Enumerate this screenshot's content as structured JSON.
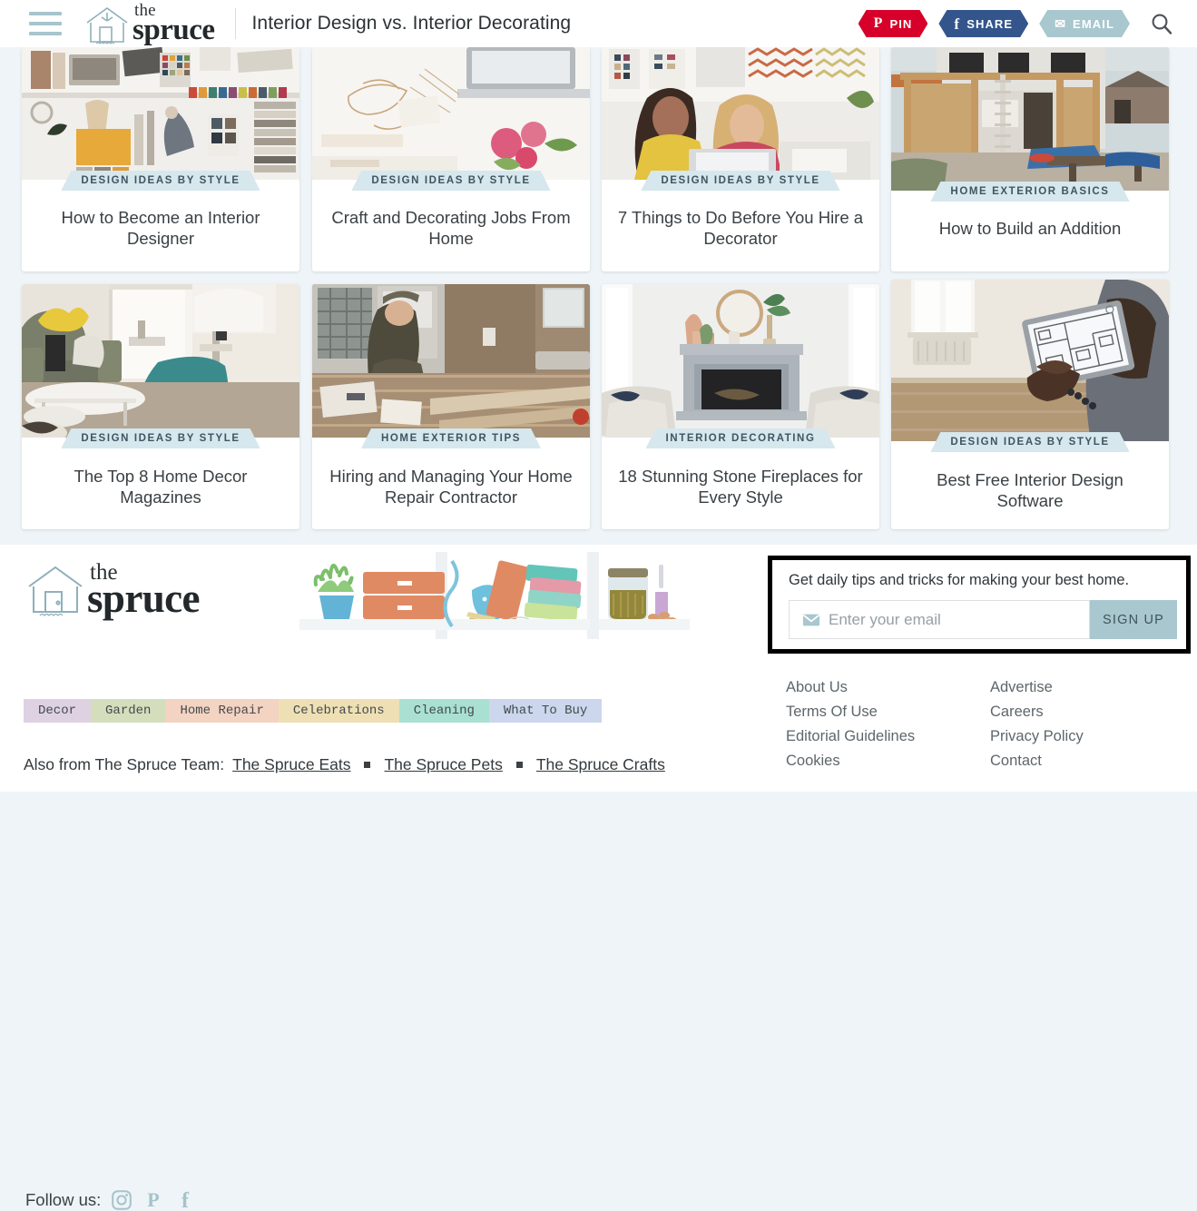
{
  "header": {
    "menu_icon": "hamburger-icon",
    "logo": {
      "the": "the",
      "spruce": "spruce"
    },
    "title": "Interior Design vs. Interior Decorating",
    "actions": [
      {
        "name": "pin",
        "label": "PIN",
        "icon": "pinterest-icon",
        "glyph": "P",
        "color": "#d6002a"
      },
      {
        "name": "share",
        "label": "SHARE",
        "icon": "facebook-icon",
        "glyph": "f",
        "color": "#33558c"
      },
      {
        "name": "email",
        "label": "EMAIL",
        "icon": "envelope-icon",
        "glyph": "✉",
        "color": "#a8c7cf"
      }
    ],
    "search_icon": "search-icon"
  },
  "cards": [
    {
      "badge": "DESIGN IDEAS BY STYLE",
      "title": "How to Become an Interior Designer",
      "image": "interior-designer-desk-swatches-photo"
    },
    {
      "badge": "DESIGN IDEAS BY STYLE",
      "title": "Craft and Decorating Jobs From Home",
      "image": "craft-desk-laptop-flowers-photo"
    },
    {
      "badge": "DESIGN IDEAS BY STYLE",
      "title": "7 Things to Do Before You Hire a Decorator",
      "image": "two-women-laptop-fabric-photo"
    },
    {
      "badge": "HOME EXTERIOR BASICS",
      "title": "How to Build an Addition",
      "image": "house-addition-construction-photo"
    },
    {
      "badge": "DESIGN IDEAS BY STYLE",
      "title": "The Top 8 Home Decor Magazines",
      "image": "living-room-sofa-teal-chair-photo"
    },
    {
      "badge": "HOME EXTERIOR TIPS",
      "title": "Hiring and Managing Your Home Repair Contractor",
      "image": "contractor-flooring-install-photo"
    },
    {
      "badge": "INTERIOR DECORATING",
      "title": "18 Stunning Stone Fireplaces for Every Style",
      "image": "stone-fireplace-living-room-photo"
    },
    {
      "badge": "DESIGN IDEAS BY STYLE",
      "title": "Best Free Interior Design Software",
      "image": "tablet-floorplan-empty-room-photo"
    }
  ],
  "footer": {
    "logo": {
      "the": "the",
      "spruce": "spruce"
    },
    "follow_label": "Follow us:",
    "social": [
      {
        "name": "instagram",
        "icon": "instagram-icon"
      },
      {
        "name": "pinterest",
        "icon": "pinterest-icon"
      },
      {
        "name": "facebook",
        "icon": "facebook-icon"
      }
    ],
    "illustration": "shelf-with-plant-boxes-books-jars-illustration",
    "tags": [
      {
        "label": "Decor",
        "color": "#ddd1e2"
      },
      {
        "label": "Garden",
        "color": "#d5debc"
      },
      {
        "label": "Home Repair",
        "color": "#f3d3c2"
      },
      {
        "label": "Celebrations",
        "color": "#eee0b4"
      },
      {
        "label": "Cleaning",
        "color": "#a9e0d2"
      },
      {
        "label": "What To Buy",
        "color": "#ccd6ec"
      }
    ],
    "also_from_label": "Also from The Spruce Team:",
    "also_from_links": [
      "The Spruce Eats",
      "The Spruce Pets",
      "The Spruce Crafts"
    ],
    "newsletter": {
      "copy": "Get daily tips and tricks for making your best home.",
      "email_icon": "envelope-icon",
      "placeholder": "Enter your email",
      "value": "",
      "submit_label": "SIGN UP",
      "submit_color": "#a8c7cf"
    },
    "links_col1": [
      "About Us",
      "Terms Of Use",
      "Editorial Guidelines",
      "Cookies"
    ],
    "links_col2": [
      "Advertise",
      "Careers",
      "Privacy Policy",
      "Contact"
    ]
  },
  "theme": {
    "page_bg": "#eef4f7",
    "badge_bg": "#d6e7ee",
    "accent": "#a8c7cf"
  }
}
